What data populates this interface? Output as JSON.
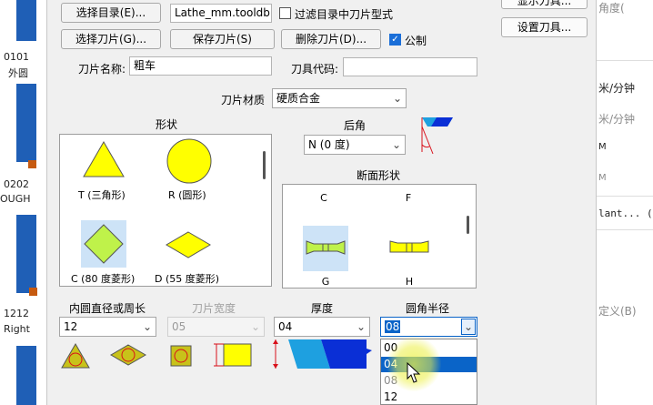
{
  "left_list": {
    "items": [
      {
        "code": "0101",
        "name": "外圆"
      },
      {
        "code": "0202",
        "name": "OUGH"
      },
      {
        "code": "1212",
        "name": "Right"
      }
    ]
  },
  "right_window": {
    "buttons": [
      "显示刀具...",
      "设置刀具..."
    ],
    "lines": [
      "角度(",
      "米/分钟",
      "米/分钟",
      "M",
      "M",
      "lant... (*)",
      "定义(B)"
    ]
  },
  "toolbar": {
    "select_dir_label": "选择目录(E)...",
    "dir_path_value": "Lathe_mm.tooldb",
    "filter_label": "过滤目录中刀片型式",
    "filter_checked": false,
    "select_insert_label": "选择刀片(G)...",
    "save_insert_label": "保存刀片(S)",
    "delete_insert_label": "删除刀片(D)...",
    "metric_label": "公制",
    "metric_checked": true
  },
  "fields": {
    "insert_name_label": "刀片名称:",
    "insert_name_value": "粗车",
    "tool_code_label": "刀具代码:",
    "tool_code_value": "",
    "material_label": "刀片材质",
    "material_value": "硬质合金"
  },
  "shape": {
    "title": "形状",
    "items": [
      {
        "label": "T (三角形)",
        "selected": false
      },
      {
        "label": "R (圆形)",
        "selected": false
      },
      {
        "label": "C (80 度菱形)",
        "selected": true
      },
      {
        "label": "D (55 度菱形)",
        "selected": false
      }
    ]
  },
  "relief": {
    "title": "后角",
    "value": "N (0 度)"
  },
  "cross_section": {
    "title": "断面形状",
    "items": [
      {
        "label": "C",
        "selected": false
      },
      {
        "label": "F",
        "selected": false
      },
      {
        "label": "G",
        "selected": true
      },
      {
        "label": "H",
        "selected": false
      }
    ]
  },
  "size": {
    "ic_label": "内圆直径或周长",
    "ic_value": "12",
    "width_label": "刀片宽度",
    "width_value": "05",
    "thickness_label": "厚度",
    "thickness_value": "04",
    "corner_radius_label": "圆角半径",
    "corner_radius_value": "08",
    "corner_radius_options": [
      "00",
      "04",
      "08",
      "12"
    ],
    "corner_radius_hover": "04"
  },
  "colors": {
    "insert_fill": "#ffff00",
    "insert_selected_fill": "#bff24a",
    "selection_bg": "#cde3f7",
    "highlight": "#0a64c8",
    "dimension_red": "#d8101a",
    "blue_tool": "#0a2fd6"
  }
}
